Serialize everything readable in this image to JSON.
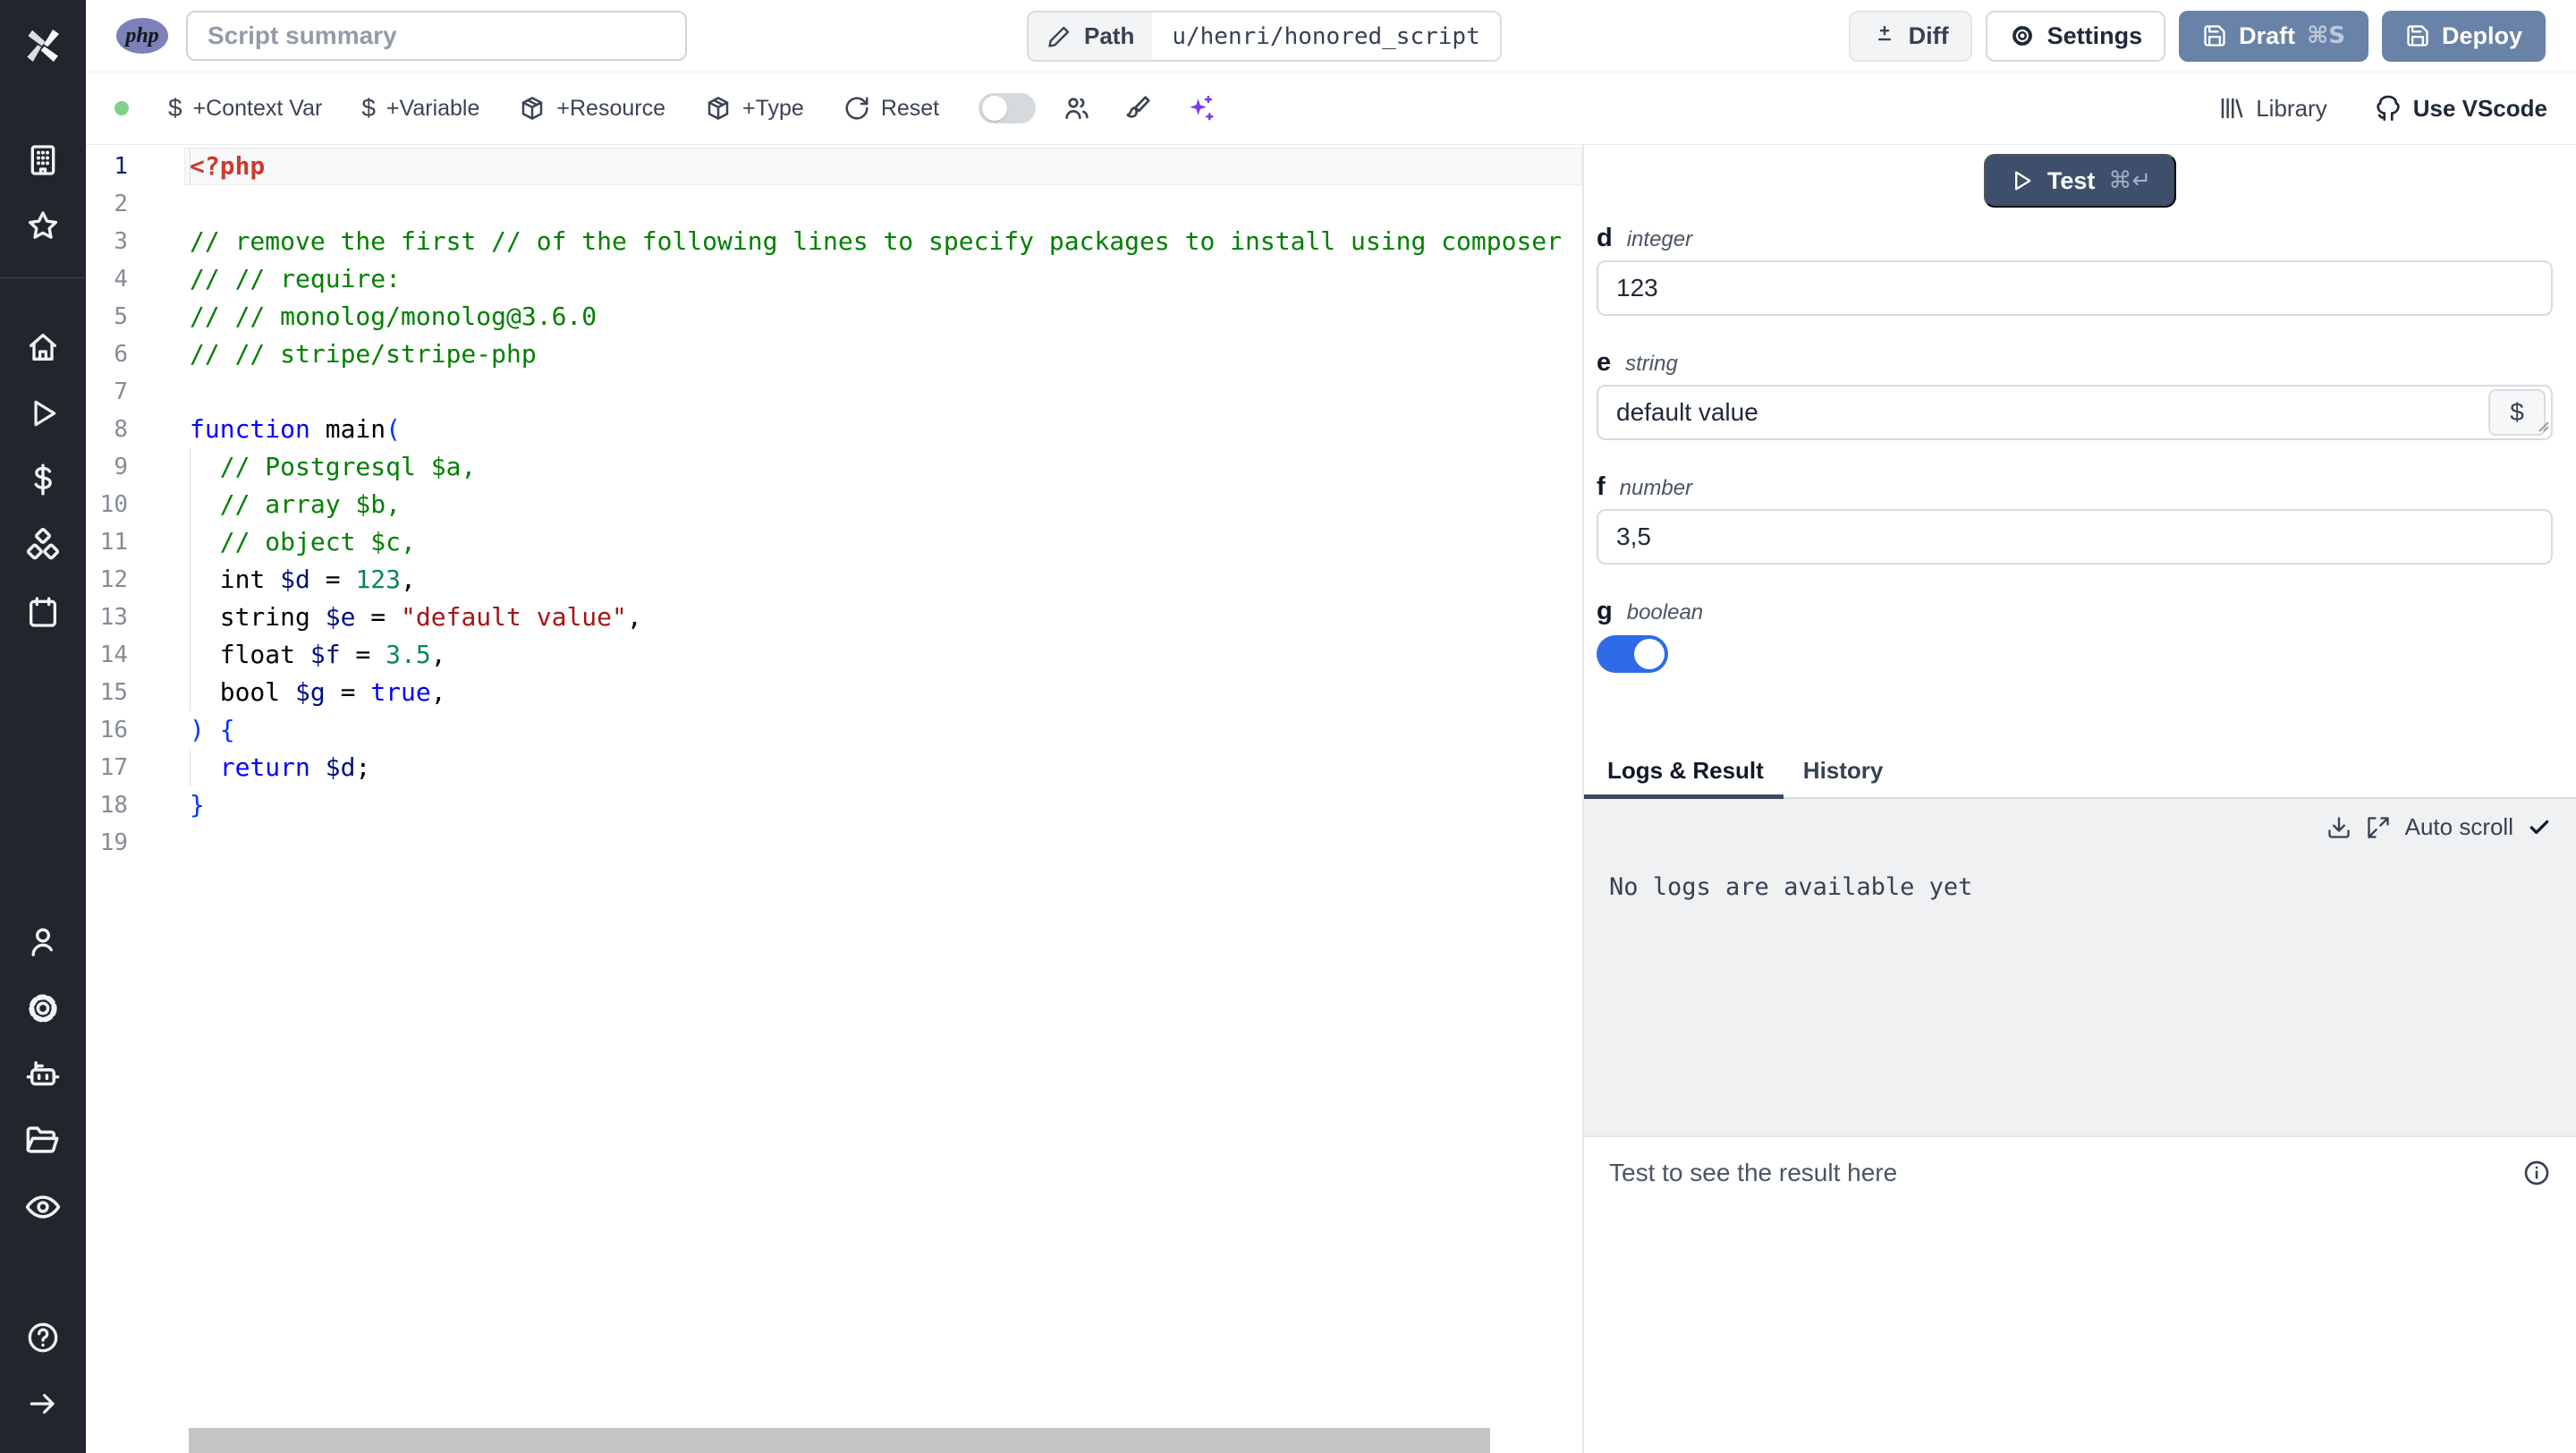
{
  "colors": {
    "php_badge": "#7c81b9",
    "primary_button": "#6982a8",
    "test_button": "#3d4f6b",
    "toggle_on": "#2f6be8",
    "ai_accent": "#7c3aed",
    "status_dot": "#7fd18a",
    "sidebar_bg": "#21262d"
  },
  "topbar": {
    "language_badge": "php",
    "summary_placeholder": "Script summary",
    "path_label": "Path",
    "path_value": "u/henri/honored_script",
    "diff_label": "Diff",
    "settings_label": "Settings",
    "draft_label": "Draft",
    "draft_shortcut": "⌘S",
    "deploy_label": "Deploy"
  },
  "toolbar": {
    "dollar_icon": "$",
    "context_var": "+Context Var",
    "variable": "+Variable",
    "resource": "+Resource",
    "type": "+Type",
    "reset": "Reset",
    "library": "Library",
    "vscode": "Use VScode"
  },
  "editor": {
    "language": "php",
    "token_colors": {
      "tag": "#cd3a2f",
      "comment": "#008000",
      "keyword": "#0000ff",
      "variable": "#001080",
      "number": "#098658",
      "string": "#a31515",
      "bracket": "#0431fa",
      "plain": "#000000"
    },
    "lines": [
      {
        "n": 1,
        "hl": true,
        "g": true,
        "seg": [
          {
            "t": "<?php",
            "c": "tag"
          }
        ]
      },
      {
        "n": 2,
        "seg": []
      },
      {
        "n": 3,
        "seg": [
          {
            "t": "// remove the first // of the following lines to specify packages to install using composer",
            "c": "comment"
          }
        ]
      },
      {
        "n": 4,
        "seg": [
          {
            "t": "// // require:",
            "c": "comment"
          }
        ]
      },
      {
        "n": 5,
        "seg": [
          {
            "t": "// // monolog/monolog@3.6.0",
            "c": "comment"
          }
        ]
      },
      {
        "n": 6,
        "seg": [
          {
            "t": "// // stripe/stripe-php",
            "c": "comment"
          }
        ]
      },
      {
        "n": 7,
        "seg": []
      },
      {
        "n": 8,
        "seg": [
          {
            "t": "function",
            "c": "keyword"
          },
          {
            "t": " main",
            "c": "plain"
          },
          {
            "t": "(",
            "c": "bracket"
          }
        ]
      },
      {
        "n": 9,
        "g": true,
        "seg": [
          {
            "t": "  // Postgresql $a,",
            "c": "comment"
          }
        ]
      },
      {
        "n": 10,
        "g": true,
        "seg": [
          {
            "t": "  // array $b,",
            "c": "comment"
          }
        ]
      },
      {
        "n": 11,
        "g": true,
        "seg": [
          {
            "t": "  // object $c,",
            "c": "comment"
          }
        ]
      },
      {
        "n": 12,
        "g": true,
        "seg": [
          {
            "t": "  int ",
            "c": "plain"
          },
          {
            "t": "$d",
            "c": "variable"
          },
          {
            "t": " = ",
            "c": "plain"
          },
          {
            "t": "123",
            "c": "number"
          },
          {
            "t": ",",
            "c": "plain"
          }
        ]
      },
      {
        "n": 13,
        "g": true,
        "seg": [
          {
            "t": "  string ",
            "c": "plain"
          },
          {
            "t": "$e",
            "c": "variable"
          },
          {
            "t": " = ",
            "c": "plain"
          },
          {
            "t": "\"default value\"",
            "c": "string"
          },
          {
            "t": ",",
            "c": "plain"
          }
        ]
      },
      {
        "n": 14,
        "g": true,
        "seg": [
          {
            "t": "  float ",
            "c": "plain"
          },
          {
            "t": "$f",
            "c": "variable"
          },
          {
            "t": " = ",
            "c": "plain"
          },
          {
            "t": "3.5",
            "c": "number"
          },
          {
            "t": ",",
            "c": "plain"
          }
        ]
      },
      {
        "n": 15,
        "g": true,
        "seg": [
          {
            "t": "  bool ",
            "c": "plain"
          },
          {
            "t": "$g",
            "c": "variable"
          },
          {
            "t": " = ",
            "c": "plain"
          },
          {
            "t": "true",
            "c": "keyword"
          },
          {
            "t": ",",
            "c": "plain"
          }
        ]
      },
      {
        "n": 16,
        "seg": [
          {
            "t": ")",
            "c": "bracket"
          },
          {
            "t": " ",
            "c": "plain"
          },
          {
            "t": "{",
            "c": "bracket"
          }
        ]
      },
      {
        "n": 17,
        "g": true,
        "seg": [
          {
            "t": "  ",
            "c": "plain"
          },
          {
            "t": "return",
            "c": "keyword"
          },
          {
            "t": " ",
            "c": "plain"
          },
          {
            "t": "$d",
            "c": "variable"
          },
          {
            "t": ";",
            "c": "plain"
          }
        ]
      },
      {
        "n": 18,
        "seg": [
          {
            "t": "}",
            "c": "bracket"
          }
        ]
      },
      {
        "n": 19,
        "seg": []
      }
    ]
  },
  "right_panel": {
    "test_label": "Test",
    "test_shortcut": "⌘↵",
    "fields": [
      {
        "name": "d",
        "type": "integer",
        "value": "123",
        "control": "input"
      },
      {
        "name": "e",
        "type": "string",
        "value": "default value",
        "control": "textarea",
        "dollar_button": "$"
      },
      {
        "name": "f",
        "type": "number",
        "value": "3,5",
        "control": "input"
      },
      {
        "name": "g",
        "type": "boolean",
        "checked": true,
        "control": "toggle"
      }
    ],
    "tabs": [
      "Logs & Result",
      "History"
    ],
    "active_tab": "Logs & Result",
    "autoscroll_label": "Auto scroll",
    "logs_empty_text": "No logs are available yet",
    "result_placeholder": "Test to see the result here"
  }
}
